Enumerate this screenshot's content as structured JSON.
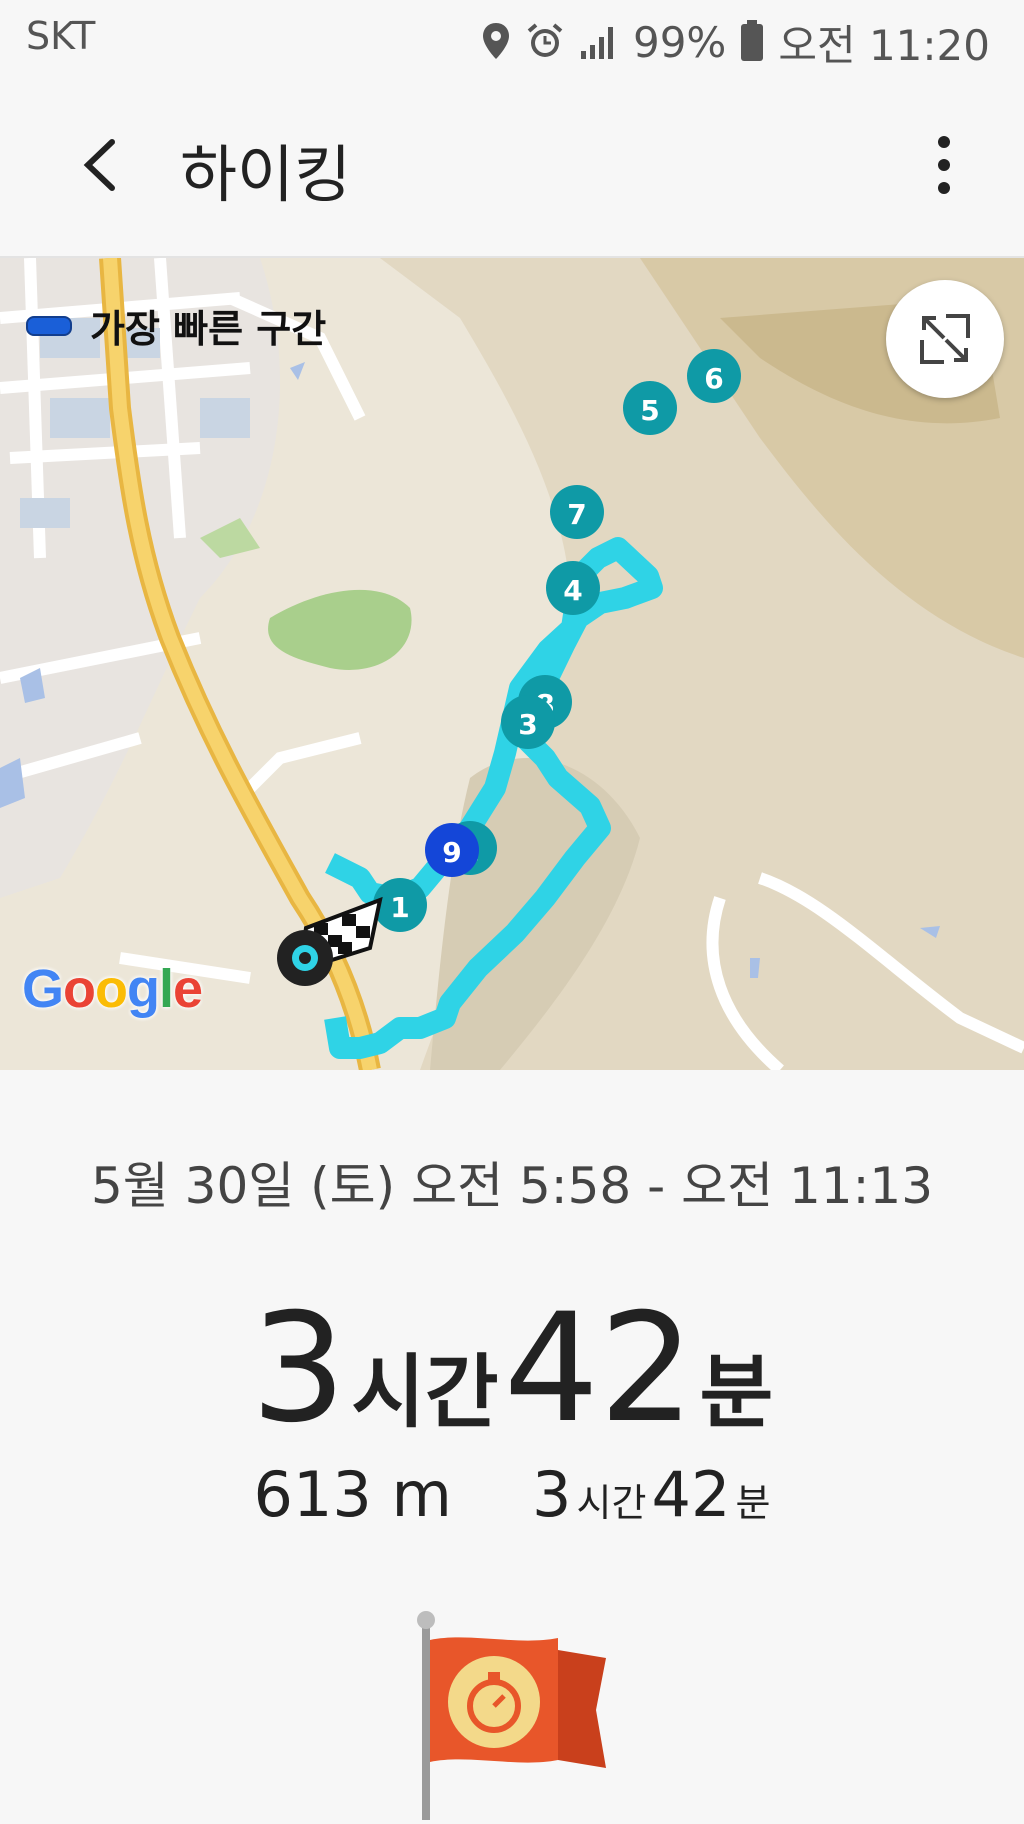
{
  "status_bar": {
    "carrier": "SKT",
    "battery": "99%",
    "time": "오전 11:20",
    "icons": [
      "location-icon",
      "alarm-icon",
      "signal-icon",
      "battery-icon"
    ]
  },
  "header": {
    "title": "하이킹",
    "back_icon": "back-arrow-icon",
    "more_icon": "more-vertical-icon"
  },
  "map": {
    "legend_label": "가장 빠른 구간",
    "legend_color": "#1a5fd8",
    "route_color": "#2fd3e6",
    "marker_color": "#0f9aa6",
    "fastest_marker_color": "#1446d8",
    "markers": [
      "1",
      "2",
      "3",
      "4",
      "5",
      "6",
      "7",
      "8",
      "9"
    ],
    "attribution": "Google"
  },
  "summary": {
    "date_range": "5월 30일 (토) 오전 5:58 - 오전 11:13",
    "duration_hours": "3",
    "duration_hours_unit": "시간",
    "duration_minutes": "42",
    "duration_minutes_unit": "분",
    "distance": "613 m",
    "moving_hours": "3",
    "moving_hours_unit": "시간",
    "moving_minutes": "42",
    "moving_minutes_unit": "분"
  }
}
